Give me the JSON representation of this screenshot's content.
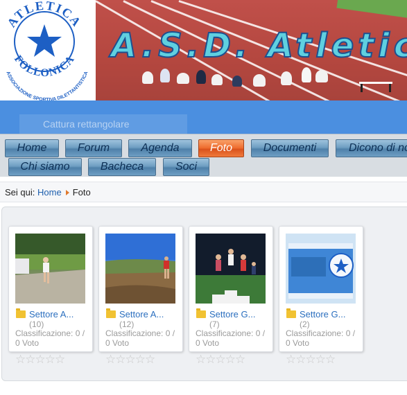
{
  "header": {
    "logo": {
      "top_text": "ATLETICA",
      "bottom_text": "FOLLONICA",
      "ring_text": "ASSOCIAZIONE SPORTIVA DILETTANTISTICA"
    },
    "site_title": "A.S.D. Atletic",
    "ghost_text": "Cattura rettangolare"
  },
  "menu": {
    "row1": [
      {
        "label": "Home",
        "active": false
      },
      {
        "label": "Forum",
        "active": false
      },
      {
        "label": "Agenda",
        "active": false
      },
      {
        "label": "Foto",
        "active": true
      },
      {
        "label": "Documenti",
        "active": false
      },
      {
        "label": "Dicono di noi",
        "active": false
      }
    ],
    "row2": [
      {
        "label": "Chi siamo",
        "active": false
      },
      {
        "label": "Bacheca",
        "active": false
      },
      {
        "label": "Soci",
        "active": false
      }
    ]
  },
  "breadcrumb": {
    "prefix": "Sei qui:",
    "home": "Home",
    "current": "Foto"
  },
  "albums": [
    {
      "name": "Settore A...",
      "count": "(10)",
      "rating_label": "Classificazione: 0 / 0 Voto",
      "stars": "☆☆☆☆☆"
    },
    {
      "name": "Settore A...",
      "count": "(12)",
      "rating_label": "Classificazione: 0 / 0 Voto",
      "stars": "☆☆☆☆☆"
    },
    {
      "name": "Settore G...",
      "count": "(7)",
      "rating_label": "Classificazione: 0 / 0 Voto",
      "stars": "☆☆☆☆☆"
    },
    {
      "name": "Settore G...",
      "count": "(2)",
      "rating_label": "Classificazione: 0 / 0 Voto",
      "stars": "☆☆☆☆☆"
    }
  ],
  "colors": {
    "accent_tab": "#ee6a2c",
    "menu_tab": "#6e9ec2",
    "link": "#2b6fbf",
    "band": "#4b8fe0"
  }
}
